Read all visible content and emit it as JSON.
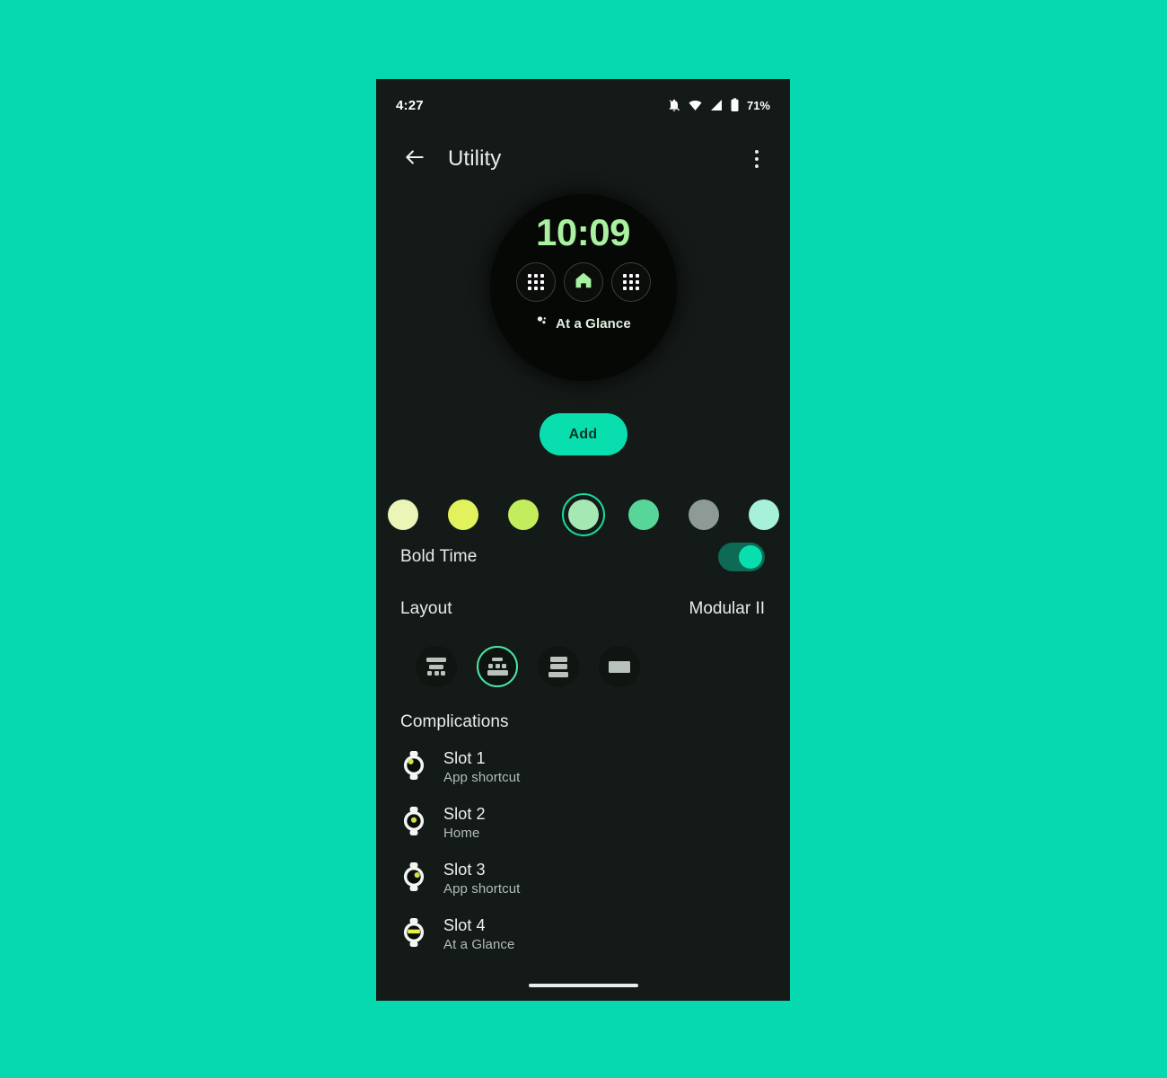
{
  "status_bar": {
    "time": "4:27",
    "battery_percent": "71%",
    "icons": [
      "notifications-off-icon",
      "wifi-icon",
      "signal-icon",
      "battery-icon"
    ]
  },
  "app_bar": {
    "back_label": "back-arrow",
    "title": "Utility",
    "overflow_label": "more-options"
  },
  "preview": {
    "time": "10:09",
    "complication_icons": [
      "grid-icon",
      "home-icon",
      "grid-icon"
    ],
    "glance_label": "At a Glance"
  },
  "actions": {
    "add_label": "Add"
  },
  "colors": {
    "selected_index": 3,
    "accent": "#09dfae",
    "swatches": [
      {
        "name": "pale-lime",
        "hex": "#eaf5b7"
      },
      {
        "name": "bright-yellow-green",
        "hex": "#e2f25c"
      },
      {
        "name": "lime",
        "hex": "#c3ed5d"
      },
      {
        "name": "mint-green",
        "hex": "#a6e8b4"
      },
      {
        "name": "emerald",
        "hex": "#58d69a"
      },
      {
        "name": "gray",
        "hex": "#8d9a95"
      },
      {
        "name": "pale-aqua",
        "hex": "#a7f0d9"
      }
    ]
  },
  "settings": {
    "bold_time": {
      "label": "Bold Time",
      "enabled": true
    },
    "layout": {
      "label": "Layout",
      "value": "Modular II",
      "selected_index": 1,
      "options": [
        {
          "name": "layout-modular-i"
        },
        {
          "name": "layout-modular-ii"
        },
        {
          "name": "layout-stacked"
        },
        {
          "name": "layout-single"
        }
      ]
    }
  },
  "complications": {
    "title": "Complications",
    "slots": [
      {
        "title": "Slot 1",
        "subtitle": "App shortcut",
        "icon": "watch-slot-top-left-icon"
      },
      {
        "title": "Slot 2",
        "subtitle": "Home",
        "icon": "watch-slot-center-icon"
      },
      {
        "title": "Slot 3",
        "subtitle": "App shortcut",
        "icon": "watch-slot-right-icon"
      },
      {
        "title": "Slot 4",
        "subtitle": "At a Glance",
        "icon": "watch-slot-bar-icon"
      }
    ]
  },
  "nav_bar": {
    "home_indicator": "home-indicator"
  }
}
